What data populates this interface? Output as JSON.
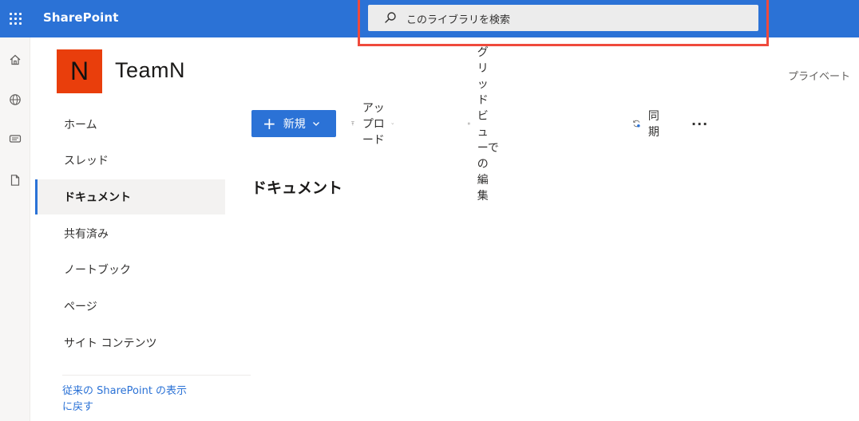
{
  "suite": {
    "app_name": "SharePoint",
    "search_placeholder": "このライブラリを検索"
  },
  "site": {
    "logo_letter": "N",
    "title": "TeamN",
    "privacy": "プライベート"
  },
  "nav": {
    "items": [
      {
        "label": "ホーム"
      },
      {
        "label": "スレッド"
      },
      {
        "label": "ドキュメント"
      },
      {
        "label": "共有済み"
      },
      {
        "label": "ノートブック"
      },
      {
        "label": "ページ"
      },
      {
        "label": "サイト コンテンツ"
      }
    ],
    "classic_link_line1": "従来の SharePoint の表示",
    "classic_link_line2": "に戻す"
  },
  "commands": {
    "new_label": "新規",
    "upload_label": "アップロード",
    "grid_edit_label": "グリッド ビューでの編集",
    "sync_label": "同期",
    "more_label": "···"
  },
  "main": {
    "heading": "ドキュメント"
  },
  "icons": {
    "waffle": "app-launcher-icon",
    "search": "search-icon",
    "rail": [
      "home-icon",
      "globe-icon",
      "news-icon",
      "file-icon"
    ]
  },
  "colors": {
    "suite_bar": "#2b72d6",
    "logo_bg": "#e93e0c",
    "highlight": "#ef4a3c"
  }
}
